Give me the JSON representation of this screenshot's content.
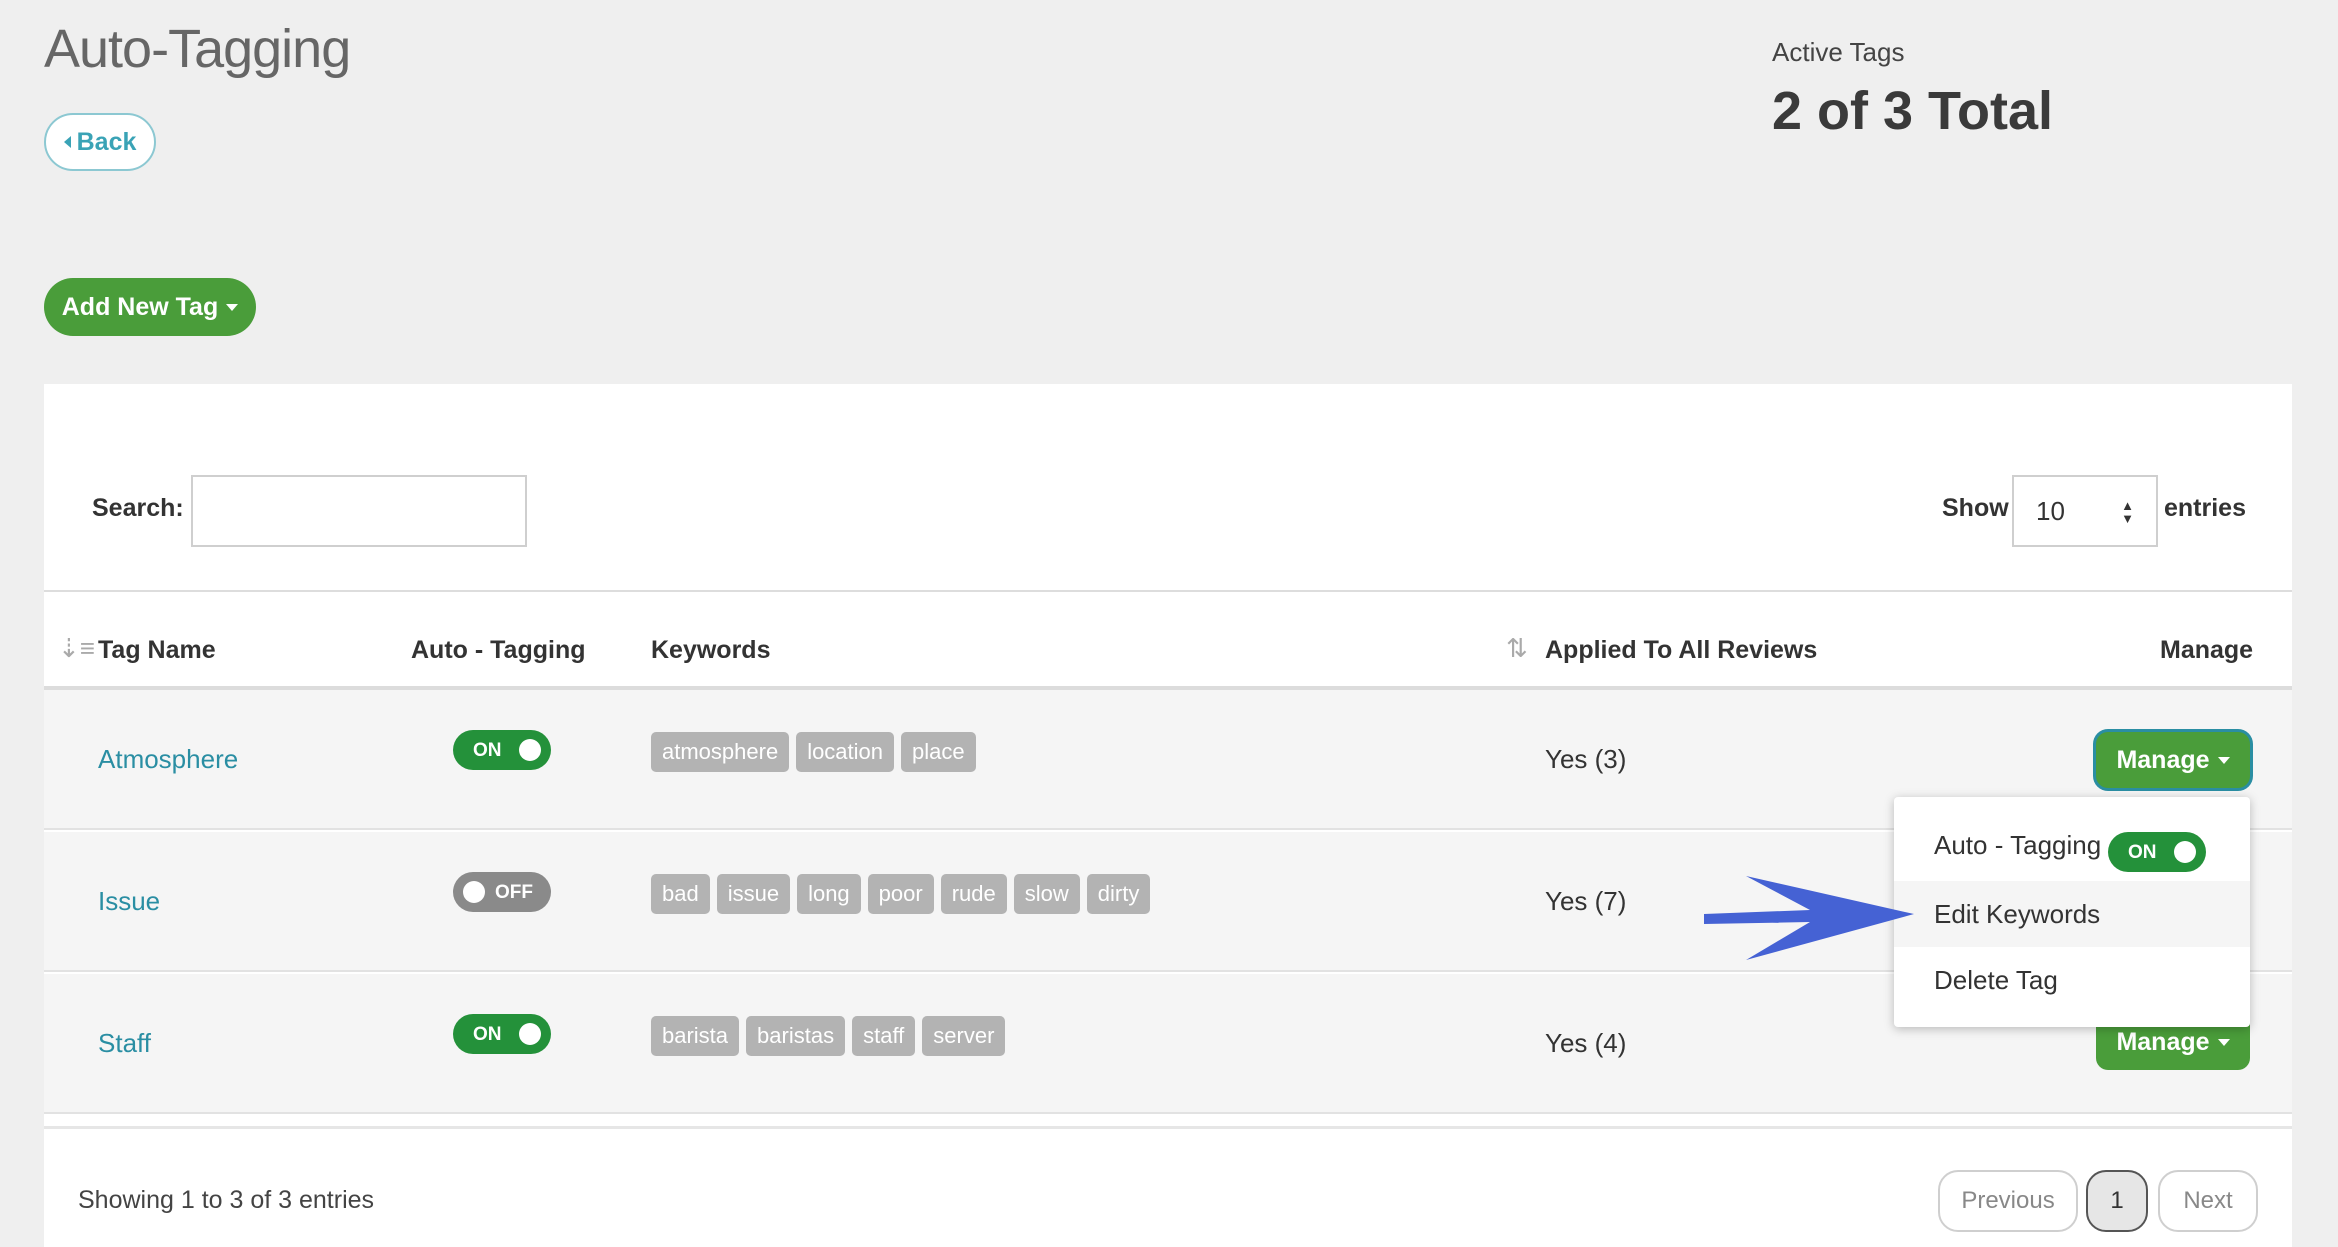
{
  "page": {
    "title": "Auto-Tagging",
    "back_label": "Back"
  },
  "stats": {
    "label": "Active Tags",
    "value": "2 of 3 Total"
  },
  "toolbar": {
    "add_label": "Add New Tag"
  },
  "table_controls": {
    "search_label": "Search:",
    "search_value": "",
    "show_label": "Show",
    "show_value": "10",
    "entries_label": "entries"
  },
  "columns": {
    "tag_name": "Tag Name",
    "auto_tagging": "Auto - Tagging",
    "keywords": "Keywords",
    "applied": "Applied To All Reviews",
    "manage": "Manage"
  },
  "rows": [
    {
      "name": "Atmosphere",
      "toggle": "ON",
      "keywords": [
        "atmosphere",
        "location",
        "place"
      ],
      "applied": "Yes (3)",
      "manage_label": "Manage"
    },
    {
      "name": "Issue",
      "toggle": "OFF",
      "keywords": [
        "bad",
        "issue",
        "long",
        "poor",
        "rude",
        "slow",
        "dirty"
      ],
      "applied": "Yes (7)",
      "manage_label": "Manage"
    },
    {
      "name": "Staff",
      "toggle": "ON",
      "keywords": [
        "barista",
        "baristas",
        "staff",
        "server"
      ],
      "applied": "Yes (4)",
      "manage_label": "Manage"
    }
  ],
  "dropdown": {
    "auto_tagging_label": "Auto - Tagging",
    "auto_tagging_toggle": "ON",
    "edit_label": "Edit Keywords",
    "delete_label": "Delete Tag"
  },
  "footer": {
    "showing": "Showing 1 to 3 of 3 entries",
    "previous": "Previous",
    "current_page": "1",
    "next": "Next"
  },
  "colors": {
    "accent_green": "#4a9d3a",
    "toggle_on": "#24913a",
    "toggle_off": "#8a8a8a",
    "link_teal": "#2a8ea3",
    "arrow_blue": "#4562d4"
  }
}
